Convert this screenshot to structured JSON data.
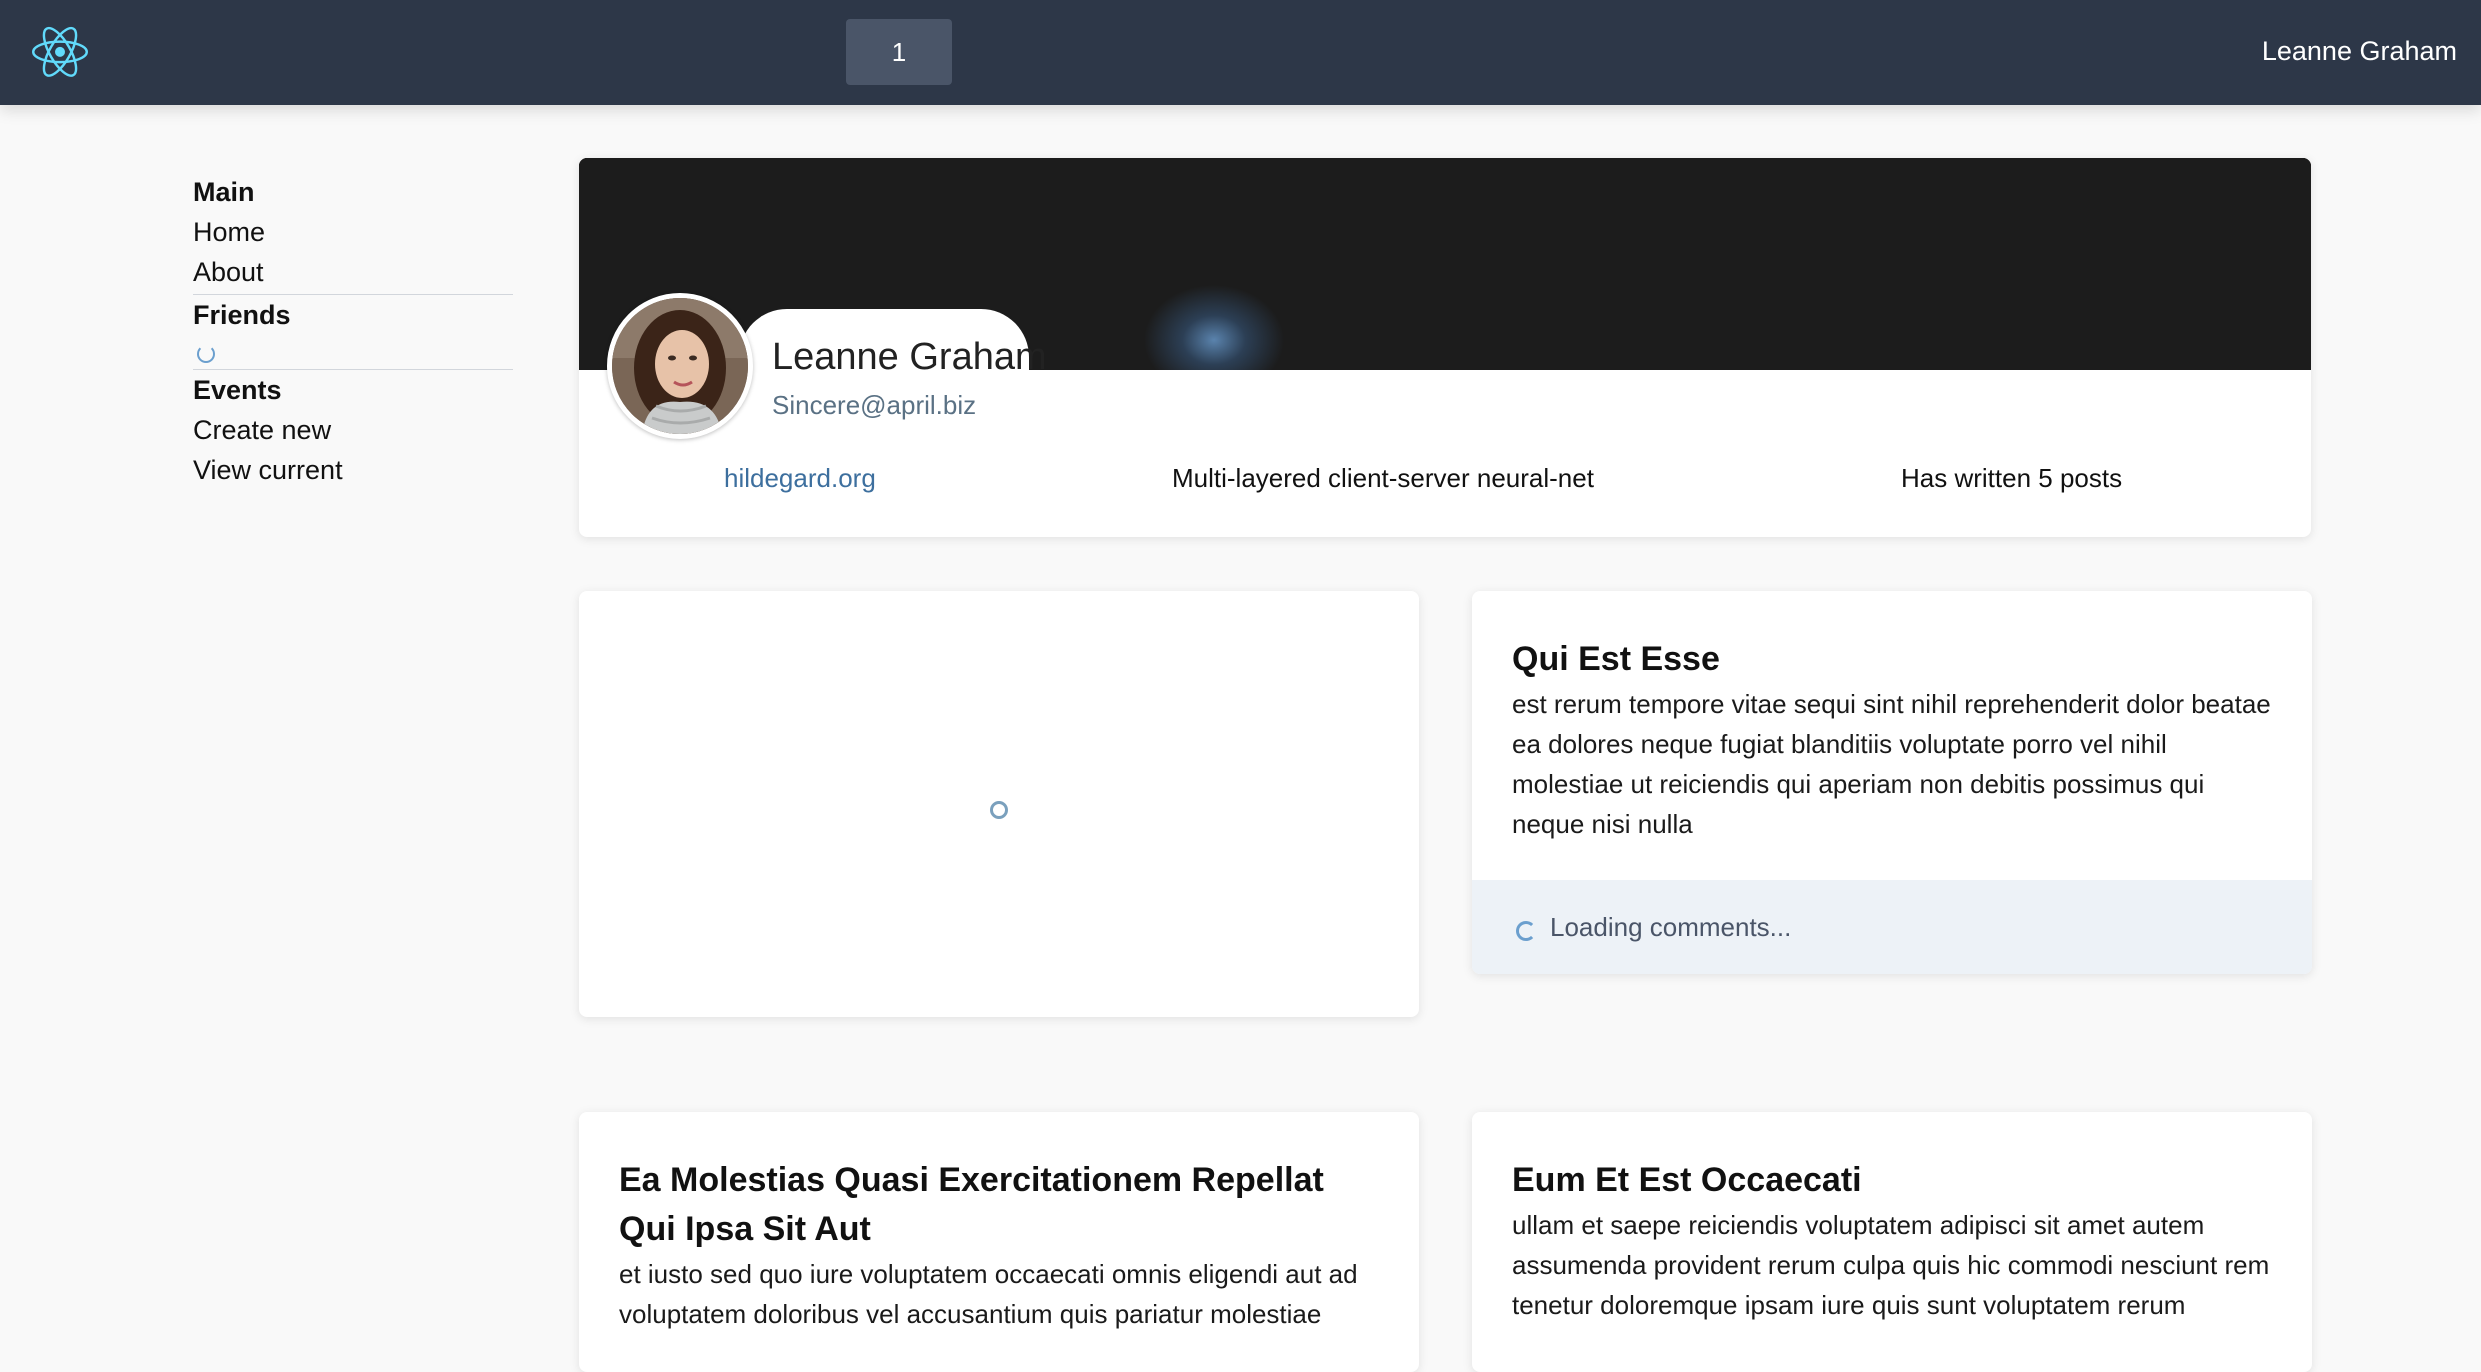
{
  "header": {
    "logo_icon": "react-atom-icon",
    "page_number": "1",
    "user_name": "Leanne Graham"
  },
  "sidebar": {
    "sections": [
      {
        "title": "Main",
        "items": [
          "Home",
          "About"
        ]
      },
      {
        "title": "Friends",
        "items": [],
        "loading": true
      },
      {
        "title": "Events",
        "items": [
          "Create new",
          "View current"
        ]
      }
    ]
  },
  "profile": {
    "name": "Leanne Graham",
    "email": "Sincere@april.biz",
    "website": "hildegard.org",
    "catch_phrase": "Multi-layered client-server neural-net",
    "posts_summary": "Has written 5 posts"
  },
  "posts": [
    {
      "title": "Qui Est Esse",
      "body": "est rerum tempore vitae sequi sint nihil reprehenderit dolor beatae ea dolores neque fugiat blanditiis voluptate porro vel nihil molestiae ut reiciendis qui aperiam non debitis possimus qui neque nisi nulla",
      "comments_status": "Loading comments..."
    },
    {
      "title": "Ea Molestias Quasi Exercitationem Repellat Qui Ipsa Sit Aut",
      "body": "et iusto sed quo iure voluptatem occaecati omnis eligendi aut ad voluptatem doloribus vel accusantium quis pariatur molestiae"
    },
    {
      "title": "Eum Et Est Occaecati",
      "body": "ullam et saepe reiciendis voluptatem adipisci sit amet autem assumenda provident rerum culpa quis hic commodi nesciunt rem tenetur doloremque ipsam iure quis sunt voluptatem rerum"
    }
  ],
  "colors": {
    "topbar": "#2d3748",
    "accent": "#61dafb",
    "link": "#3d6f9e",
    "comments_bg": "#edf2f7"
  }
}
